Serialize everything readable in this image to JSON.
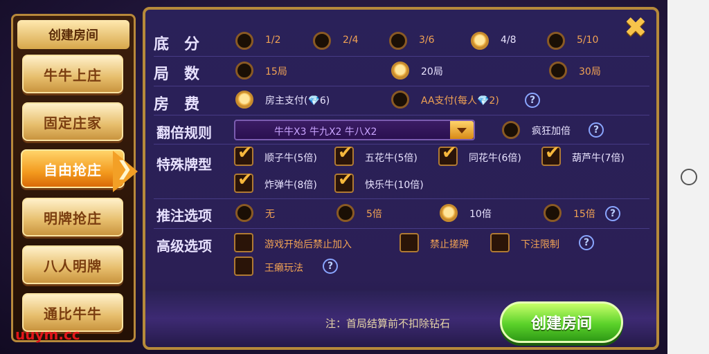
{
  "left_panel": {
    "header": "创建房间",
    "modes": [
      {
        "label": "牛牛上庄",
        "active": false
      },
      {
        "label": "固定庄家",
        "active": false
      },
      {
        "label": "自由抢庄",
        "active": true
      },
      {
        "label": "明牌抢庄",
        "active": false
      },
      {
        "label": "八人明牌",
        "active": false
      },
      {
        "label": "通比牛牛",
        "active": false
      }
    ]
  },
  "rows": {
    "base_score": {
      "label": "底　分",
      "options": [
        "1/2",
        "2/4",
        "3/6",
        "4/8",
        "5/10"
      ],
      "selected": "4/8"
    },
    "rounds": {
      "label": "局　数",
      "options": [
        "15局",
        "20局",
        "30局"
      ],
      "selected": "20局"
    },
    "room_fee": {
      "label": "房　费",
      "options": [
        "房主支付(💎6)",
        "AA支付(每人💎2)"
      ],
      "selected": "房主支付(💎6)"
    },
    "multiplier": {
      "label": "翻倍规则",
      "dropdown_value": "牛牛X3  牛九X2  牛八X2",
      "extra_option": "疯狂加倍"
    },
    "special": {
      "label": "特殊牌型",
      "options": [
        "顺子牛(5倍)",
        "五花牛(5倍)",
        "同花牛(6倍)",
        "葫芦牛(7倍)",
        "炸弹牛(8倍)",
        "快乐牛(10倍)"
      ]
    },
    "push_bet": {
      "label": "推注选项",
      "options": [
        "无",
        "5倍",
        "10倍",
        "15倍"
      ],
      "selected": "10倍"
    },
    "advanced": {
      "label": "高级选项",
      "options": [
        "游戏开始后禁止加入",
        "禁止搓牌",
        "下注限制",
        "王癞玩法"
      ]
    }
  },
  "footer": {
    "note": "注：首局结算前不扣除钻石",
    "create_label": "创建房间"
  },
  "close_icon": "close-x-icon",
  "help_icon": "?",
  "watermark": "uuym.cc",
  "colors": {
    "accent": "#f3a026",
    "panel": "#2a2159",
    "option_text": "#f0a254",
    "create": "#5bd22a"
  }
}
